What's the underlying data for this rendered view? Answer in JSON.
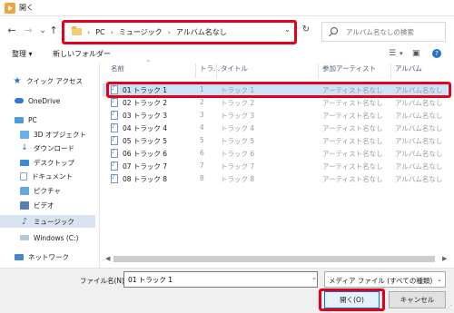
{
  "window": {
    "title": "開く"
  },
  "navigation": {
    "back": "←",
    "forward": "→",
    "recent": "⌄",
    "up": "↑",
    "breadcrumbs": [
      "PC",
      "ミュージック",
      "アルバム名なし"
    ],
    "refresh": "↻",
    "search_placeholder": "アルバム名なしの検索"
  },
  "toolbar": {
    "organize": "整理 ▾",
    "new_folder": "新しいフォルダー"
  },
  "sidebar": {
    "items": [
      {
        "label": "クイック アクセス",
        "icon": "star-icon"
      },
      {
        "label": "OneDrive",
        "icon": "cloud-icon"
      },
      {
        "label": "PC",
        "icon": "pc-icon"
      },
      {
        "label": "3D オブジェクト",
        "icon": "cube-icon"
      },
      {
        "label": "ダウンロード",
        "icon": "download-icon"
      },
      {
        "label": "デスクトップ",
        "icon": "desktop-icon"
      },
      {
        "label": "ドキュメント",
        "icon": "document-icon"
      },
      {
        "label": "ピクチャ",
        "icon": "picture-icon"
      },
      {
        "label": "ビデオ",
        "icon": "video-icon"
      },
      {
        "label": "ミュージック",
        "icon": "music-icon",
        "selected": true
      },
      {
        "label": "Windows (C:)",
        "icon": "drive-icon"
      },
      {
        "label": "ネットワーク",
        "icon": "network-icon"
      }
    ]
  },
  "file_list": {
    "columns": [
      "名前",
      "トラ...",
      "タイトル",
      "参加アーティスト",
      "アルバム"
    ],
    "rows": [
      {
        "name": "01 トラック 1",
        "num": "1",
        "title": "トラック 1",
        "artist": "アーティスト名なし",
        "album": "アルバム名なし",
        "selected": true
      },
      {
        "name": "02 トラック 2",
        "num": "2",
        "title": "トラック 2",
        "artist": "アーティスト名なし",
        "album": "アルバム名なし"
      },
      {
        "name": "03 トラック 3",
        "num": "3",
        "title": "トラック 3",
        "artist": "アーティスト名なし",
        "album": "アルバム名なし"
      },
      {
        "name": "04 トラック 4",
        "num": "4",
        "title": "トラック 4",
        "artist": "アーティスト名なし",
        "album": "アルバム名なし"
      },
      {
        "name": "05 トラック 5",
        "num": "5",
        "title": "トラック 5",
        "artist": "アーティスト名なし",
        "album": "アルバム名なし"
      },
      {
        "name": "06 トラック 6",
        "num": "6",
        "title": "トラック 6",
        "artist": "アーティスト名なし",
        "album": "アルバム名なし"
      },
      {
        "name": "07 トラック 7",
        "num": "7",
        "title": "トラック 7",
        "artist": "アーティスト名なし",
        "album": "アルバム名なし"
      },
      {
        "name": "08 トラック 8",
        "num": "8",
        "title": "トラック 8",
        "artist": "アーティスト名なし",
        "album": "アルバム名なし"
      }
    ]
  },
  "footer": {
    "filename_label": "ファイル名(N):",
    "filename_value": "01 トラック 1",
    "filetype": "メディア ファイル (すべての種類)",
    "open_button": "開く(O)",
    "cancel_button": "キャンセル"
  },
  "colors": {
    "highlight": "#e4001b",
    "selection": "#cce4f7",
    "accent": "#0078d7"
  }
}
